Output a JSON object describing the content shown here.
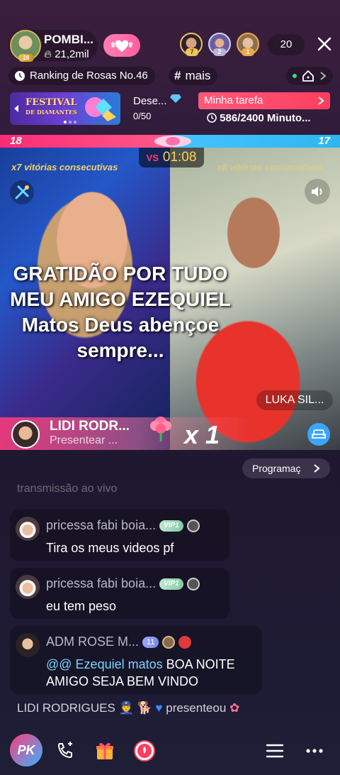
{
  "host": {
    "name": "POMBI...",
    "level": "28",
    "fans": "21,2mil",
    "fans_icon": "flame-icon"
  },
  "top_viewers": [
    {
      "rank": "7",
      "badge_color": "#f2c45a"
    },
    {
      "rank": "2",
      "badge_color": "#b9b4d8"
    },
    {
      "rank": "1",
      "badge_color": "#f0a84a"
    }
  ],
  "viewer_count": "20",
  "ranking": {
    "label": "Ranking de Rosas No.46"
  },
  "tag": {
    "label": "mais"
  },
  "banner": {
    "festival_line1": "FESTIVAL",
    "festival_line2": "DE DIAMANTES"
  },
  "desejo": {
    "label": "Dese...",
    "progress": "0/50"
  },
  "task": {
    "label": "Minha tarefa",
    "time": "586/2400 Minuto..."
  },
  "pk": {
    "left_score": "18",
    "right_score": "17",
    "vs_label": "VS",
    "timer": "01:08",
    "left_streak": "x7 vitórias consecutivas",
    "right_streak": "x8 vitórias consecutivas",
    "left_share": 0.51
  },
  "overlay": {
    "text": "GRATIDÃO POR TUDO MEU AMIGO EZEQUIEL Matos Deus abençoe sempre..."
  },
  "guest": {
    "name": "LUKA SIL..."
  },
  "gift": {
    "sender": "LIDI RODR...",
    "action": "Presentear ...",
    "count": "x 1"
  },
  "schedule_button": "Programaç",
  "chat": {
    "faded": "transmissão ao vivo",
    "messages": [
      {
        "name": "pricessa fabi boia...",
        "vip": "VIP1",
        "text": "Tira os meus videos pf"
      },
      {
        "name": "pricessa fabi boia...",
        "vip": "VIP1",
        "text": "eu tem peso"
      },
      {
        "name": "ADM ROSE M...",
        "level": "11",
        "mention": "@@ Ezequiel matos",
        "text": " BOA NOITE AMIGO SEJA BEM VINDO"
      }
    ],
    "system": {
      "user": "LIDI RODRIGUES",
      "action": "presenteou"
    }
  },
  "bottom": {
    "pk_label": "PK"
  },
  "colors": {
    "accent_pink": "#ff3d7a",
    "accent_blue": "#38b2ff",
    "mention": "#7fd3ff"
  }
}
